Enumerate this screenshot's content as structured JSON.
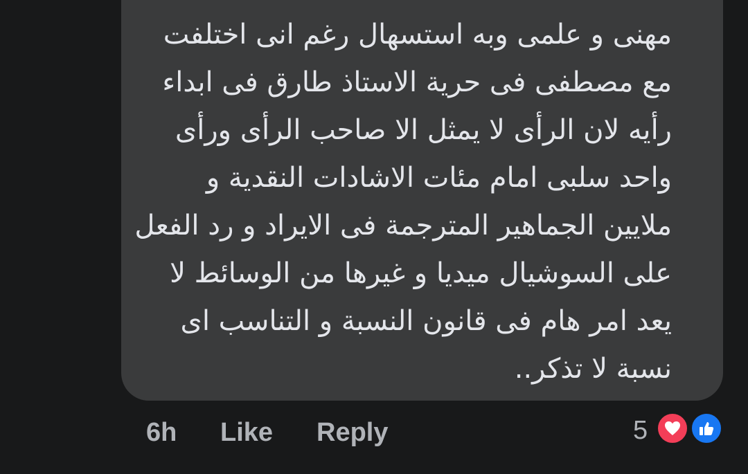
{
  "comment": {
    "lines": [
      "مهنى و علمى    وبه استسهال رغم انى اختلفت",
      "مع مصطفى فى حرية الاستاذ طارق فى ابداء",
      "رأيه لان الرأى لا يمثل الا صاحب الرأى  ورأى",
      "واحد سلبى  امام مئات الاشادات النقدية و",
      "ملايين الجماهير المترجمة فى الايراد و رد الفعل",
      "على السوشيال ميديا و غيرها من الوسائط لا",
      "يعد امر هام فى قانون النسبة و التناسب اى",
      "نسبة لا تذكر.."
    ]
  },
  "footer": {
    "timestamp": "6h",
    "like_label": "Like",
    "reply_label": "Reply",
    "reaction_count": "5"
  },
  "reactions": [
    {
      "icon": "heart-icon",
      "color": "#f33e58"
    },
    {
      "icon": "thumbs-up-icon",
      "color": "#1877f2"
    }
  ],
  "colors": {
    "background": "#18191a",
    "bubble": "#3a3b3c",
    "text": "#e4e6eb",
    "muted": "#b0b3b8"
  }
}
